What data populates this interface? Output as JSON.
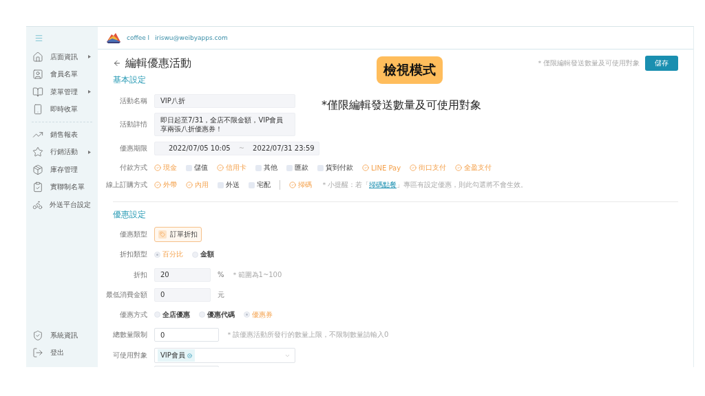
{
  "header": {
    "store": "coffee l",
    "email": "iriswu@weibyapps.com"
  },
  "sidebar": {
    "groups": [
      {
        "items": [
          {
            "label": "店面資訊",
            "has_submenu": true
          },
          {
            "label": "會員名單",
            "has_submenu": false
          },
          {
            "label": "菜單管理",
            "has_submenu": true
          },
          {
            "label": "即時收單",
            "has_submenu": false
          }
        ]
      },
      {
        "items": [
          {
            "label": "銷售報表",
            "has_submenu": false
          },
          {
            "label": "行銷活動",
            "has_submenu": true
          },
          {
            "label": "庫存管理",
            "has_submenu": false
          },
          {
            "label": "實聯制名單",
            "has_submenu": false
          },
          {
            "label": "外送平台設定",
            "has_submenu": false
          }
        ]
      }
    ],
    "bottom_items": [
      {
        "label": "系統資訊"
      },
      {
        "label": "登出"
      }
    ]
  },
  "page": {
    "title": "編輯優惠活動",
    "notice": "＊僅限編輯發送數量及可使用對象",
    "save_button": "儲存"
  },
  "annotation": {
    "badge": "檢視模式",
    "note": "*僅限編輯發送數量及可使用對象"
  },
  "basic": {
    "title": "基本設定",
    "name": {
      "label": "活動名稱",
      "value": "VIP八折",
      "disabled": true
    },
    "details": {
      "label": "活動詳情",
      "value": "即日起至7/31，全店不限金額，VIP會員享兩張八折優惠券！",
      "disabled": true
    },
    "period": {
      "label": "優惠期限",
      "start": "2022/07/05 10:05",
      "separator": "~",
      "end": "2022/07/31 23:59",
      "disabled": true
    },
    "payment": {
      "label": "付款方式",
      "options": [
        {
          "label": "現金",
          "checked": true
        },
        {
          "label": "儲值",
          "checked": false
        },
        {
          "label": "信用卡",
          "checked": true
        },
        {
          "label": "其他",
          "checked": false
        },
        {
          "label": "匯款",
          "checked": false
        },
        {
          "label": "貨到付款",
          "checked": false
        },
        {
          "label": "LINE Pay",
          "checked": true
        },
        {
          "label": "街口支付",
          "checked": true
        },
        {
          "label": "全盈支付",
          "checked": true
        }
      ]
    },
    "online_order": {
      "label": "線上訂購方式",
      "options": [
        {
          "label": "外帶",
          "checked": true
        },
        {
          "label": "內用",
          "checked": true
        },
        {
          "label": "外送",
          "checked": false
        },
        {
          "label": "宅配",
          "checked": false
        }
      ],
      "extra_options": [
        {
          "label": "掃碼",
          "checked": true
        }
      ],
      "hint_before": "＊小提醒：若「",
      "hint_link": "掃碼點餐",
      "hint_after": "」專區有設定優惠，則此勾選將不會生效。"
    }
  },
  "discount": {
    "title": "優惠設定",
    "type": {
      "label": "優惠類型",
      "options": [
        {
          "label": "訂單折扣",
          "selected": true
        }
      ]
    },
    "discount_type": {
      "label": "折扣類型",
      "options": [
        {
          "label": "百分比",
          "selected": true
        },
        {
          "label": "金額",
          "selected": false
        }
      ]
    },
    "rate": {
      "label": "折扣",
      "value": "20",
      "unit": "%",
      "hint": "＊範圍為1~100",
      "disabled": true
    },
    "minimum": {
      "label": "最低消費金額",
      "value": "0",
      "unit": "元",
      "disabled": true
    },
    "method": {
      "label": "優惠方式",
      "options": [
        {
          "label": "全店優惠",
          "selected": false
        },
        {
          "label": "優惠代碼",
          "selected": false
        },
        {
          "label": "優惠券",
          "selected": true
        }
      ]
    },
    "quantity": {
      "label": "總數量限制",
      "value": "0",
      "hint": "＊該優惠活動所發行的數量上限，不限制數量請輸入0",
      "disabled": false
    },
    "audience": {
      "label": "可使用對象",
      "tags": [
        "VIP會員"
      ]
    }
  }
}
